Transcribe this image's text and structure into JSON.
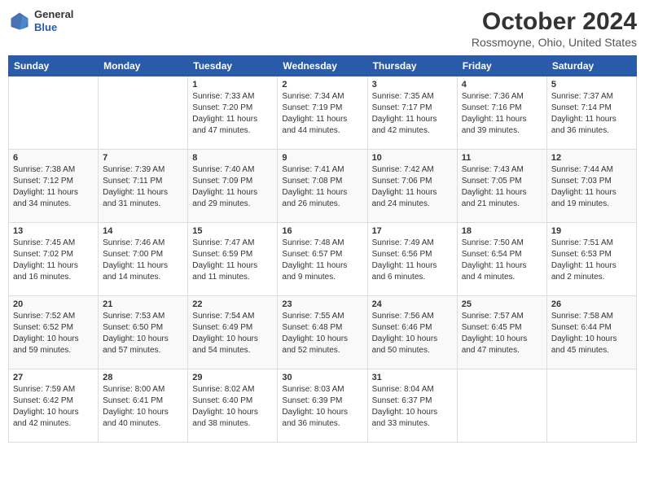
{
  "header": {
    "logo_general": "General",
    "logo_blue": "Blue",
    "title": "October 2024",
    "subtitle": "Rossmoyne, Ohio, United States"
  },
  "weekdays": [
    "Sunday",
    "Monday",
    "Tuesday",
    "Wednesday",
    "Thursday",
    "Friday",
    "Saturday"
  ],
  "weeks": [
    [
      {
        "day": "",
        "sunrise": "",
        "sunset": "",
        "daylight": ""
      },
      {
        "day": "",
        "sunrise": "",
        "sunset": "",
        "daylight": ""
      },
      {
        "day": "1",
        "sunrise": "Sunrise: 7:33 AM",
        "sunset": "Sunset: 7:20 PM",
        "daylight": "Daylight: 11 hours and 47 minutes."
      },
      {
        "day": "2",
        "sunrise": "Sunrise: 7:34 AM",
        "sunset": "Sunset: 7:19 PM",
        "daylight": "Daylight: 11 hours and 44 minutes."
      },
      {
        "day": "3",
        "sunrise": "Sunrise: 7:35 AM",
        "sunset": "Sunset: 7:17 PM",
        "daylight": "Daylight: 11 hours and 42 minutes."
      },
      {
        "day": "4",
        "sunrise": "Sunrise: 7:36 AM",
        "sunset": "Sunset: 7:16 PM",
        "daylight": "Daylight: 11 hours and 39 minutes."
      },
      {
        "day": "5",
        "sunrise": "Sunrise: 7:37 AM",
        "sunset": "Sunset: 7:14 PM",
        "daylight": "Daylight: 11 hours and 36 minutes."
      }
    ],
    [
      {
        "day": "6",
        "sunrise": "Sunrise: 7:38 AM",
        "sunset": "Sunset: 7:12 PM",
        "daylight": "Daylight: 11 hours and 34 minutes."
      },
      {
        "day": "7",
        "sunrise": "Sunrise: 7:39 AM",
        "sunset": "Sunset: 7:11 PM",
        "daylight": "Daylight: 11 hours and 31 minutes."
      },
      {
        "day": "8",
        "sunrise": "Sunrise: 7:40 AM",
        "sunset": "Sunset: 7:09 PM",
        "daylight": "Daylight: 11 hours and 29 minutes."
      },
      {
        "day": "9",
        "sunrise": "Sunrise: 7:41 AM",
        "sunset": "Sunset: 7:08 PM",
        "daylight": "Daylight: 11 hours and 26 minutes."
      },
      {
        "day": "10",
        "sunrise": "Sunrise: 7:42 AM",
        "sunset": "Sunset: 7:06 PM",
        "daylight": "Daylight: 11 hours and 24 minutes."
      },
      {
        "day": "11",
        "sunrise": "Sunrise: 7:43 AM",
        "sunset": "Sunset: 7:05 PM",
        "daylight": "Daylight: 11 hours and 21 minutes."
      },
      {
        "day": "12",
        "sunrise": "Sunrise: 7:44 AM",
        "sunset": "Sunset: 7:03 PM",
        "daylight": "Daylight: 11 hours and 19 minutes."
      }
    ],
    [
      {
        "day": "13",
        "sunrise": "Sunrise: 7:45 AM",
        "sunset": "Sunset: 7:02 PM",
        "daylight": "Daylight: 11 hours and 16 minutes."
      },
      {
        "day": "14",
        "sunrise": "Sunrise: 7:46 AM",
        "sunset": "Sunset: 7:00 PM",
        "daylight": "Daylight: 11 hours and 14 minutes."
      },
      {
        "day": "15",
        "sunrise": "Sunrise: 7:47 AM",
        "sunset": "Sunset: 6:59 PM",
        "daylight": "Daylight: 11 hours and 11 minutes."
      },
      {
        "day": "16",
        "sunrise": "Sunrise: 7:48 AM",
        "sunset": "Sunset: 6:57 PM",
        "daylight": "Daylight: 11 hours and 9 minutes."
      },
      {
        "day": "17",
        "sunrise": "Sunrise: 7:49 AM",
        "sunset": "Sunset: 6:56 PM",
        "daylight": "Daylight: 11 hours and 6 minutes."
      },
      {
        "day": "18",
        "sunrise": "Sunrise: 7:50 AM",
        "sunset": "Sunset: 6:54 PM",
        "daylight": "Daylight: 11 hours and 4 minutes."
      },
      {
        "day": "19",
        "sunrise": "Sunrise: 7:51 AM",
        "sunset": "Sunset: 6:53 PM",
        "daylight": "Daylight: 11 hours and 2 minutes."
      }
    ],
    [
      {
        "day": "20",
        "sunrise": "Sunrise: 7:52 AM",
        "sunset": "Sunset: 6:52 PM",
        "daylight": "Daylight: 10 hours and 59 minutes."
      },
      {
        "day": "21",
        "sunrise": "Sunrise: 7:53 AM",
        "sunset": "Sunset: 6:50 PM",
        "daylight": "Daylight: 10 hours and 57 minutes."
      },
      {
        "day": "22",
        "sunrise": "Sunrise: 7:54 AM",
        "sunset": "Sunset: 6:49 PM",
        "daylight": "Daylight: 10 hours and 54 minutes."
      },
      {
        "day": "23",
        "sunrise": "Sunrise: 7:55 AM",
        "sunset": "Sunset: 6:48 PM",
        "daylight": "Daylight: 10 hours and 52 minutes."
      },
      {
        "day": "24",
        "sunrise": "Sunrise: 7:56 AM",
        "sunset": "Sunset: 6:46 PM",
        "daylight": "Daylight: 10 hours and 50 minutes."
      },
      {
        "day": "25",
        "sunrise": "Sunrise: 7:57 AM",
        "sunset": "Sunset: 6:45 PM",
        "daylight": "Daylight: 10 hours and 47 minutes."
      },
      {
        "day": "26",
        "sunrise": "Sunrise: 7:58 AM",
        "sunset": "Sunset: 6:44 PM",
        "daylight": "Daylight: 10 hours and 45 minutes."
      }
    ],
    [
      {
        "day": "27",
        "sunrise": "Sunrise: 7:59 AM",
        "sunset": "Sunset: 6:42 PM",
        "daylight": "Daylight: 10 hours and 42 minutes."
      },
      {
        "day": "28",
        "sunrise": "Sunrise: 8:00 AM",
        "sunset": "Sunset: 6:41 PM",
        "daylight": "Daylight: 10 hours and 40 minutes."
      },
      {
        "day": "29",
        "sunrise": "Sunrise: 8:02 AM",
        "sunset": "Sunset: 6:40 PM",
        "daylight": "Daylight: 10 hours and 38 minutes."
      },
      {
        "day": "30",
        "sunrise": "Sunrise: 8:03 AM",
        "sunset": "Sunset: 6:39 PM",
        "daylight": "Daylight: 10 hours and 36 minutes."
      },
      {
        "day": "31",
        "sunrise": "Sunrise: 8:04 AM",
        "sunset": "Sunset: 6:37 PM",
        "daylight": "Daylight: 10 hours and 33 minutes."
      },
      {
        "day": "",
        "sunrise": "",
        "sunset": "",
        "daylight": ""
      },
      {
        "day": "",
        "sunrise": "",
        "sunset": "",
        "daylight": ""
      }
    ]
  ]
}
